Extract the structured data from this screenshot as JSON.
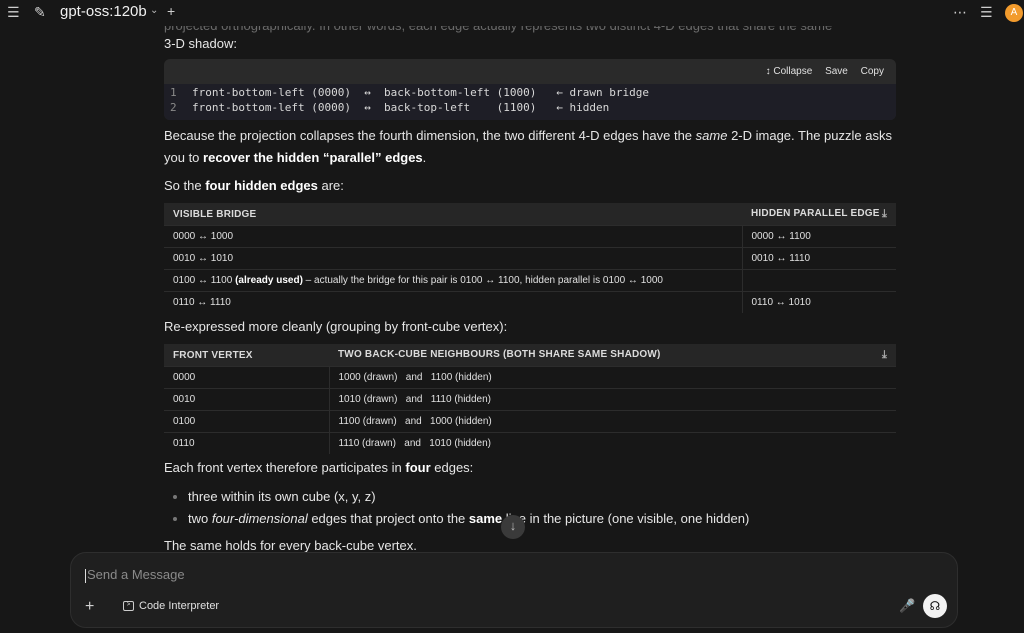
{
  "topbar": {
    "model": "gpt-oss:120b",
    "avatar_initial": "A"
  },
  "faded_line": "projected orthographically. In other words, each edge actually represents two distinct 4-D edges that share the same",
  "p_shadow": "3-D shadow:",
  "code": {
    "collapse": "Collapse",
    "save": "Save",
    "copy": "Copy",
    "lines": [
      {
        "n": "1",
        "text": "front-bottom-left (0000)  ↔  back-bottom-left (1000)   ← drawn bridge"
      },
      {
        "n": "2",
        "text": "front-bottom-left (0000)  ↔  back-top-left    (1100)   ← hidden"
      }
    ]
  },
  "p_because": {
    "a": "Because the projection collapses the fourth dimension, the two different 4-D edges have the ",
    "em": "same",
    "b": " 2-D image. The puzzle asks",
    "c": "you to ",
    "strong": "recover the hidden “parallel” edges",
    "d": "."
  },
  "p_so": {
    "a": "So the ",
    "strong": "four hidden edges",
    "b": " are:"
  },
  "table1": {
    "headers": [
      "VISIBLE BRIDGE",
      "HIDDEN PARALLEL EDGE"
    ],
    "rows": [
      {
        "c1": "0000 ↔ 1000",
        "c2": "0000 ↔ 1100"
      },
      {
        "c1": "0010 ↔ 1010",
        "c2": "0010 ↔ 1110"
      },
      {
        "c1a": "0100 ↔ 1100 ",
        "c1b": "(already used)",
        "c1c": " – actually the bridge for this pair is 0100 ↔ 1100, hidden parallel is 0100 ↔ 1000",
        "c2": ""
      },
      {
        "c1": "0110 ↔ 1110",
        "c2": "0110 ↔ 1010"
      }
    ]
  },
  "p_reexp": "Re-expressed more cleanly (grouping by front-cube vertex):",
  "table2": {
    "headers": [
      "FRONT VERTEX",
      "TWO BACK-CUBE NEIGHBOURS (BOTH SHARE SAME SHADOW)"
    ],
    "rows": [
      {
        "c1": "0000",
        "c2": "1000 (drawn)   and   1100 (hidden)"
      },
      {
        "c1": "0010",
        "c2": "1010 (drawn)   and   1110 (hidden)"
      },
      {
        "c1": "0100",
        "c2": "1100 (drawn)   and   1000 (hidden)"
      },
      {
        "c1": "0110",
        "c2": "1110 (drawn)   and   1010 (hidden)"
      }
    ]
  },
  "p_each": {
    "a": "Each front vertex therefore participates in ",
    "strong": "four",
    "b": " edges:"
  },
  "bullets": {
    "b1": "three within its own cube (x, y, z)",
    "b2a": "two ",
    "b2em": "four-dimensional",
    "b2b": " edges that project onto the ",
    "b2strong": "same",
    "b2c": " line in the picture (one visible, one hidden)"
  },
  "p_same": "The same holds for every back-cube vertex.",
  "input": {
    "placeholder": "Send a Message",
    "tool": "Code Interpreter"
  }
}
